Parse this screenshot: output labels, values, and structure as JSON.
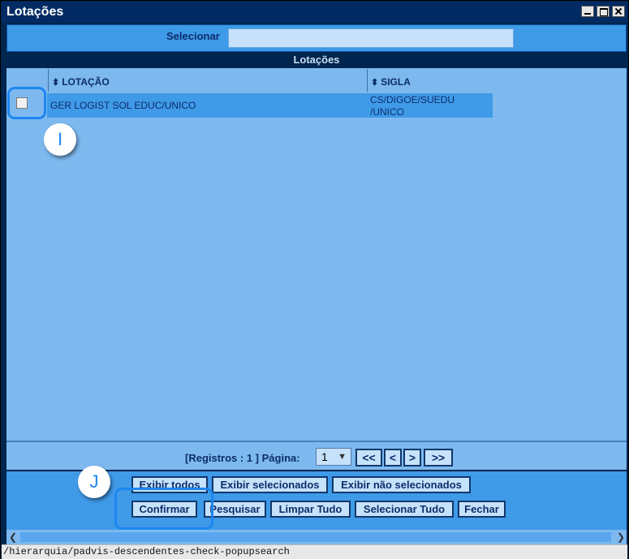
{
  "window": {
    "title": "Lotações"
  },
  "search": {
    "label": "Selecionar",
    "value": ""
  },
  "grid": {
    "title": "Lotações",
    "columns": [
      "LOTAÇÃO",
      "SIGLA"
    ],
    "rows": [
      {
        "lotacao": "GER LOGIST SOL EDUC/UNICO",
        "sigla": "CS/DIGOE/SUEDU /UNICO",
        "checked": false
      }
    ]
  },
  "callouts": {
    "i": "I",
    "j": "J"
  },
  "pager": {
    "text": "[Registros : 1 ] Página:",
    "page": "1",
    "buttons": [
      "<<",
      "<",
      ">",
      ">>"
    ]
  },
  "actions": {
    "row1": [
      "Exibir todos",
      "Exibir selecionados",
      "Exibir não selecionados"
    ],
    "row2": [
      "Confirmar",
      "Pesquisar",
      "Limpar Tudo",
      "Selecionar Tudo",
      "Fechar"
    ]
  },
  "status": {
    "url": "/hierarquia/padvis-descendentes-check-popupsearch"
  },
  "colors": {
    "accent": "#1d87f0",
    "panel": "#3f9ae8",
    "background": "#7db9ef",
    "dark": "#00254e"
  }
}
